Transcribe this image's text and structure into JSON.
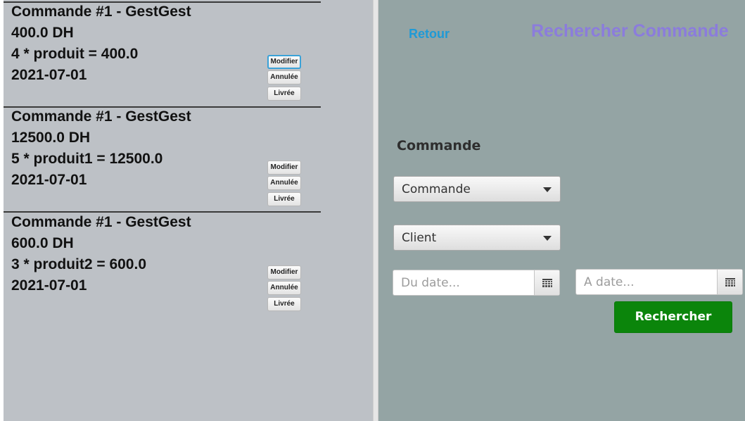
{
  "orders": [
    {
      "title": "Commande #1 - GestGest",
      "total": "400.0 DH",
      "detail": "4 * produit = 400.0",
      "date": "2021-07-01",
      "buttons": {
        "modify": "Modifier",
        "cancelled": "Annulée",
        "delivered": "Livrée"
      }
    },
    {
      "title": "Commande #1 - GestGest",
      "total": "12500.0 DH",
      "detail": "5 * produit1 = 12500.0",
      "date": "2021-07-01",
      "buttons": {
        "modify": "Modifier",
        "cancelled": "Annulée",
        "delivered": "Livrée"
      }
    },
    {
      "title": "Commande #1 - GestGest",
      "total": "600.0 DH",
      "detail": "3 * produit2 = 600.0",
      "date": "2021-07-01",
      "buttons": {
        "modify": "Modifier",
        "cancelled": "Annulée",
        "delivered": "Livrée"
      }
    }
  ],
  "search_panel": {
    "back_label": "Retour",
    "title": "Rechercher Commande",
    "section_label": "Commande",
    "order_select": {
      "value": "Commande"
    },
    "client_select": {
      "value": "Client"
    },
    "from_date": {
      "value": "",
      "placeholder": "Du date...",
      "icon": "calendar-icon"
    },
    "to_date": {
      "value": "",
      "placeholder": "A date...",
      "icon": "calendar-icon"
    },
    "search_label": "Rechercher"
  },
  "colors": {
    "list_background": "#bdc1c6",
    "panel_background": "#94a4a4",
    "title_color": "#8b7cdc",
    "link_color": "#1f9ad6",
    "search_button": "#0b850b"
  }
}
